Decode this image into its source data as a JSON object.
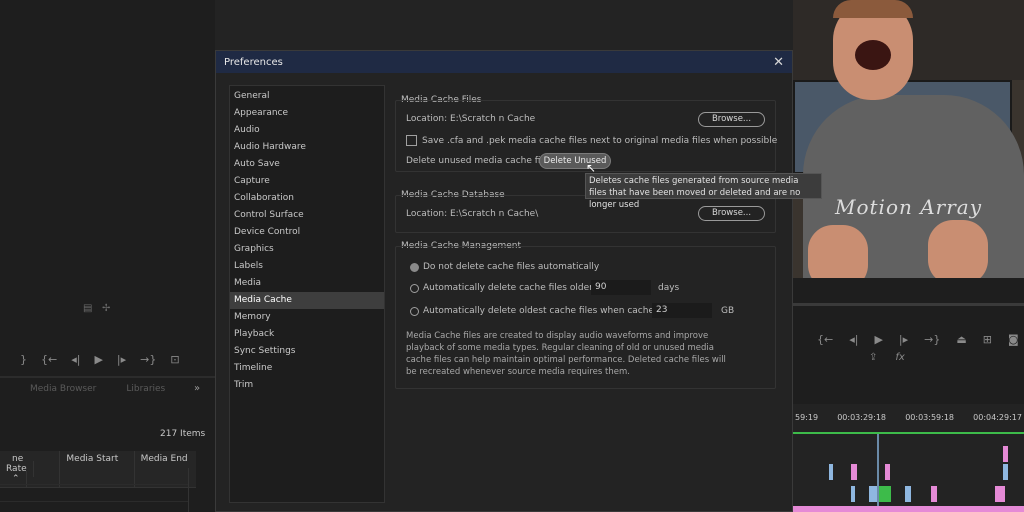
{
  "dialog": {
    "title": "Preferences",
    "close_glyph": "✕"
  },
  "sidebar": {
    "items": [
      {
        "label": "General"
      },
      {
        "label": "Appearance"
      },
      {
        "label": "Audio"
      },
      {
        "label": "Audio Hardware"
      },
      {
        "label": "Auto Save"
      },
      {
        "label": "Capture"
      },
      {
        "label": "Collaboration"
      },
      {
        "label": "Control Surface"
      },
      {
        "label": "Device Control"
      },
      {
        "label": "Graphics"
      },
      {
        "label": "Labels"
      },
      {
        "label": "Media"
      },
      {
        "label": "Media Cache"
      },
      {
        "label": "Memory"
      },
      {
        "label": "Playback"
      },
      {
        "label": "Sync Settings"
      },
      {
        "label": "Timeline"
      },
      {
        "label": "Trim"
      }
    ],
    "selected": "Media Cache"
  },
  "media_cache_files": {
    "title": "Media Cache Files",
    "location_label": "Location:",
    "location_value": "E:\\Scratch n Cache",
    "browse_label": "Browse...",
    "checkbox_label": "Save .cfa and .pek media cache files next to original media files when possible",
    "delete_label": "Delete unused media cache files",
    "delete_button": "Delete Unused"
  },
  "tooltip": {
    "text": "Deletes cache files generated from source media files that have been moved or deleted and are no longer used"
  },
  "media_cache_database": {
    "title": "Media Cache Database",
    "location_label": "Location:",
    "location_value": "E:\\Scratch n Cache\\",
    "browse_label": "Browse..."
  },
  "media_cache_management": {
    "title": "Media Cache Management",
    "option_none": "Do not delete cache files automatically",
    "option_older": "Automatically delete cache files older than:",
    "older_value": "90",
    "older_unit": "days",
    "option_size": "Automatically delete oldest cache files when cache exceeds:",
    "size_value": "23",
    "size_unit": "GB",
    "description": "Media Cache files are created to display audio waveforms and improve playback of some media types.  Regular cleaning of old or unused media cache files can help maintain optimal performance. Deleted cache files will be recreated whenever source media requires them."
  },
  "background": {
    "panel_tabs": [
      "Media Browser",
      "Libraries"
    ],
    "overflow": "»",
    "items_count": "217 Items",
    "columns": [
      "ne Rate",
      "Media Start",
      "Media End"
    ],
    "timecodes": [
      "59:19",
      "00:03:29:18",
      "00:03:59:18",
      "00:04:29:17"
    ],
    "video_logo": "Motion Array"
  },
  "colors": {
    "titlebar": "#1f2a44",
    "selected_item": "#3e3e3e",
    "timeline_green": "#3dbb4a",
    "clip_pink": "#e58ad6",
    "clip_blue": "#8fb7e0"
  }
}
